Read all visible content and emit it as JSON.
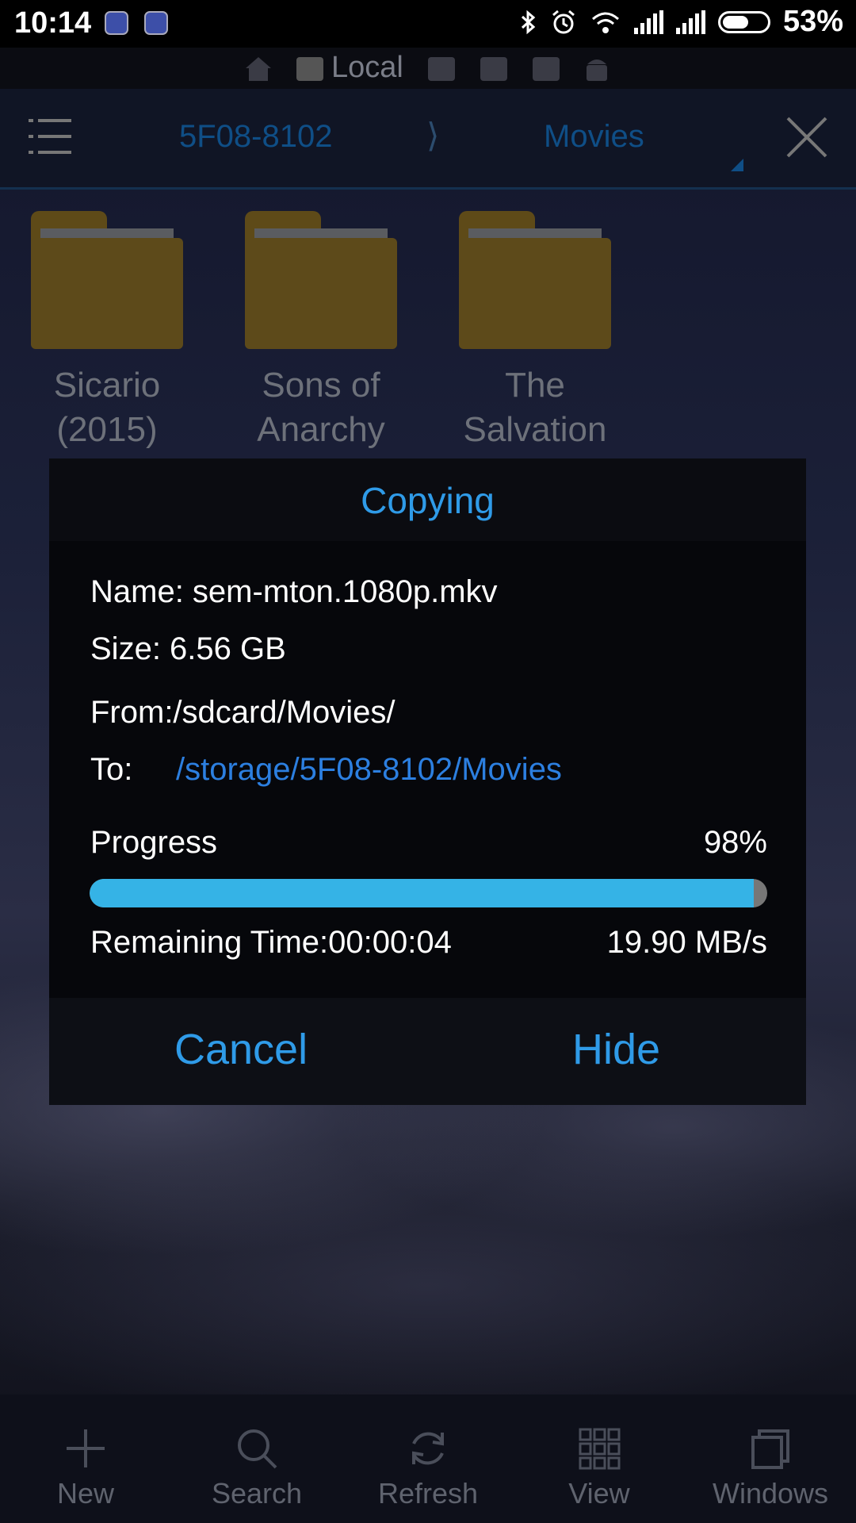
{
  "status_bar": {
    "time": "10:14",
    "battery_percent": "53%",
    "icons": [
      "app-icon",
      "app-icon",
      "bluetooth-icon",
      "alarm-icon",
      "wifi-icon",
      "signal-icon",
      "signal-icon",
      "battery-icon"
    ]
  },
  "location_tabs": {
    "active_label": "Local",
    "icons": [
      "home-icon",
      "sd-card-icon",
      "sd-card-icon",
      "sd-card-icon",
      "sd-card-icon",
      "android-icon"
    ]
  },
  "toolbar": {
    "breadcrumb": [
      "5F08-8102",
      "Movies"
    ],
    "separator": "⟩",
    "icons": [
      "menu-icon",
      "close-icon"
    ]
  },
  "folders": [
    {
      "name_line1": "Sicario",
      "name_line2": "(2015)"
    },
    {
      "name_line1": "Sons of",
      "name_line2": "Anarchy"
    },
    {
      "name_line1": "The",
      "name_line2": "Salvation"
    }
  ],
  "dialog": {
    "title": "Copying",
    "name_line": "Name: sem-mton.1080p.mkv",
    "size_line": "Size: 6.56 GB",
    "from_line": "From:/sdcard/Movies/",
    "to_label": "To:",
    "to_path": "/storage/5F08-8102/Movies",
    "progress_label": "Progress",
    "progress_percent": "98%",
    "progress_value": 0.98,
    "remaining_time": "Remaining Time:00:00:04",
    "speed": "19.90 MB/s",
    "cancel_label": "Cancel",
    "hide_label": "Hide"
  },
  "bottom_bar": {
    "items": [
      {
        "label": "New",
        "icon": "plus-icon"
      },
      {
        "label": "Search",
        "icon": "search-icon"
      },
      {
        "label": "Refresh",
        "icon": "refresh-icon"
      },
      {
        "label": "View",
        "icon": "grid-view-icon"
      },
      {
        "label": "Windows",
        "icon": "windows-icon"
      }
    ]
  },
  "colors": {
    "accent": "#2f9be8",
    "progress": "#35b3e6",
    "link": "#2c7fe0",
    "folder": "#5d4a1a"
  }
}
